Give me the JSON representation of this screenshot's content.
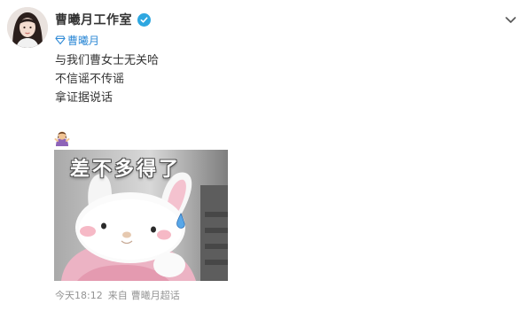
{
  "post": {
    "username": "曹曦月工作室",
    "tag_label": "曹曦月",
    "lines": [
      "与我们曹女士无关哈",
      "不信谣不传谣",
      "拿证据说话"
    ],
    "media_caption": "差不多得了",
    "footer": {
      "time": "今天18:12",
      "from_label": "来自",
      "source": "曹曦月超话"
    }
  },
  "icons": {
    "verified": "verified-badge-icon",
    "tag": "supertopic-diamond-icon",
    "caret": "chevron-down-icon",
    "emoji": "person-gesture-emoji-icon"
  },
  "colors": {
    "link_blue": "#2f8ad6",
    "verified_blue": "#2ea7e0",
    "meta_gray": "#939393",
    "text": "#333333"
  }
}
